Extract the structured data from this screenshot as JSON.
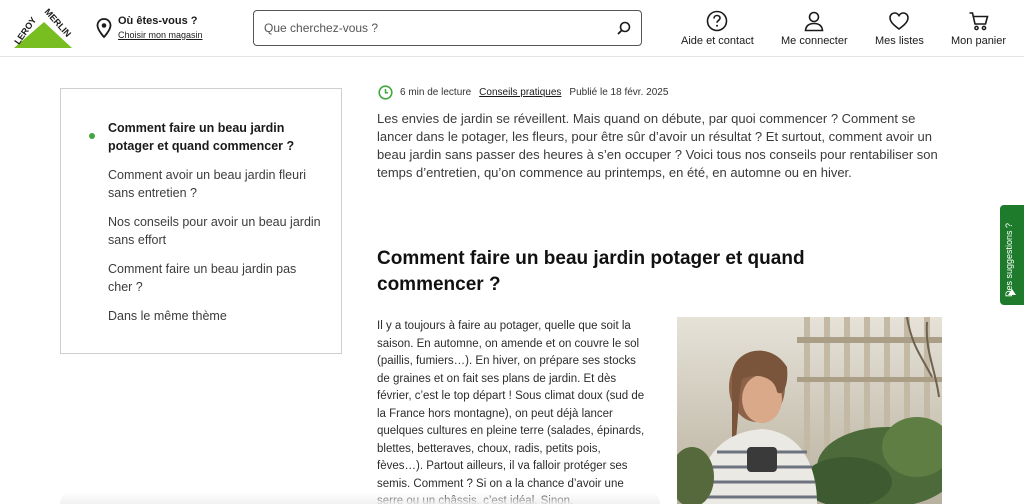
{
  "header": {
    "store_question": "Où êtes-vous ?",
    "store_link": "Choisir mon magasin",
    "search_placeholder": "Que cherchez-vous ?",
    "nav": [
      {
        "label": "Aide et contact",
        "icon": "help-icon"
      },
      {
        "label": "Me connecter",
        "icon": "user-icon"
      },
      {
        "label": "Mes listes",
        "icon": "heart-icon"
      },
      {
        "label": "Mon panier",
        "icon": "cart-icon"
      }
    ],
    "logo_text_1": "LEROY",
    "logo_text_2": "MERLIN",
    "brand_color": "#78be20"
  },
  "toc": {
    "items": [
      "Comment faire un beau jardin potager et quand commencer ?",
      "Comment avoir un beau jardin fleuri sans entretien ?",
      "Nos conseils pour avoir un beau jardin sans effort",
      "Comment faire un beau jardin pas cher ?",
      "Dans le même thème"
    ],
    "active_index": 0,
    "active_color": "#3ea83d"
  },
  "article": {
    "read_time": "6 min de lecture",
    "category": "Conseils pratiques",
    "published": "Publié le 18 févr. 2025",
    "intro": "Les envies de jardin se réveillent. Mais quand on débute, par quoi commencer ? Comment se lancer dans le potager, les fleurs, pour être sûr d’avoir un résultat ? Et surtout, comment avoir un beau jardin sans passer des heures à s’en occuper ? Voici tous nos conseils pour rentabiliser son temps d’entretien, qu’on commence au printemps, en été, en automne ou en hiver.",
    "section_title": "Comment faire un beau jardin potager et quand commencer ?",
    "section_body": "Il y a toujours à faire au potager, quelle que soit la saison. En automne, on amende et on couvre le sol (paillis, fumiers…). En hiver, on prépare ses stocks de graines et on fait ses plans de jardin. Et dès février, c’est le top départ ! Sous climat doux (sud de la France hors montagne), on peut déjà lancer quelques cultures en pleine terre (salades, épinards, blettes, betteraves, choux, radis, petits pois, fèves…). Partout ailleurs, il va falloir protéger ses semis. Comment ? Si on a la chance d’avoir une serre ou un châssis, c’est idéal. Sinon,"
  },
  "side_tab": {
    "label": "Des suggestions ?",
    "color": "#1e7b2b"
  }
}
